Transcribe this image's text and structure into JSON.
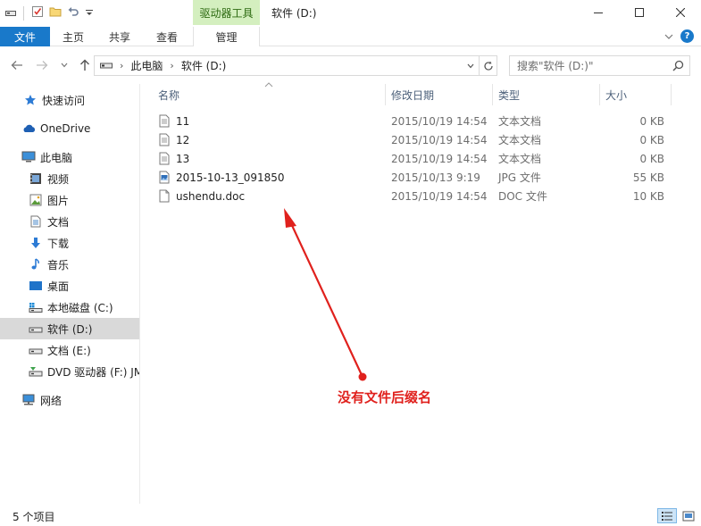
{
  "window": {
    "title": "软件 (D:)",
    "context_tab_header": "驱动器工具",
    "controls": {
      "minimize": "─",
      "maximize": "☐",
      "close": "✕"
    }
  },
  "ribbon": {
    "tabs": [
      {
        "label": "文件"
      },
      {
        "label": "主页"
      },
      {
        "label": "共享"
      },
      {
        "label": "查看"
      },
      {
        "label": "管理"
      }
    ],
    "help_label": "?"
  },
  "address": {
    "crumbs": [
      "此电脑",
      "软件 (D:)"
    ],
    "separator": "›"
  },
  "search": {
    "placeholder": "搜索\"软件 (D:)\""
  },
  "nav": {
    "items": [
      {
        "label": "快速访问",
        "icon": "star-icon"
      },
      {
        "label": "OneDrive",
        "icon": "cloud-icon"
      },
      {
        "label": "此电脑",
        "icon": "computer-icon"
      },
      {
        "label": "视频",
        "icon": "video-icon"
      },
      {
        "label": "图片",
        "icon": "picture-icon"
      },
      {
        "label": "文档",
        "icon": "document-icon"
      },
      {
        "label": "下载",
        "icon": "download-icon"
      },
      {
        "label": "音乐",
        "icon": "music-icon"
      },
      {
        "label": "桌面",
        "icon": "desktop-icon"
      },
      {
        "label": "本地磁盘 (C:)",
        "icon": "windows-drive-icon"
      },
      {
        "label": "软件 (D:)",
        "icon": "drive-icon",
        "selected": true
      },
      {
        "label": "文档 (E:)",
        "icon": "drive-icon"
      },
      {
        "label": "DVD 驱动器 (F:) JM",
        "icon": "dvd-drive-icon"
      },
      {
        "label": "网络",
        "icon": "network-icon"
      }
    ]
  },
  "columns": {
    "name": "名称",
    "date": "修改日期",
    "type": "类型",
    "size": "大小"
  },
  "files": [
    {
      "name": "11",
      "date": "2015/10/19 14:54",
      "type": "文本文档",
      "size": "0 KB",
      "icon": "text-file-icon"
    },
    {
      "name": "12",
      "date": "2015/10/19 14:54",
      "type": "文本文档",
      "size": "0 KB",
      "icon": "text-file-icon"
    },
    {
      "name": "13",
      "date": "2015/10/19 14:54",
      "type": "文本文档",
      "size": "0 KB",
      "icon": "text-file-icon"
    },
    {
      "name": "2015-10-13_091850",
      "date": "2015/10/13 9:19",
      "type": "JPG 文件",
      "size": "55 KB",
      "icon": "image-file-icon"
    },
    {
      "name": "ushendu.doc",
      "date": "2015/10/19 14:54",
      "type": "DOC 文件",
      "size": "10 KB",
      "icon": "doc-file-icon"
    }
  ],
  "annotation": {
    "text": "没有文件后缀名",
    "color": "#e0211d"
  },
  "status": {
    "item_count": "5 个项目"
  },
  "colors": {
    "accent": "#1979ca",
    "context_tab": "#d4efbf",
    "selected_nav": "#d9d9d9",
    "annotation": "#e0211d"
  }
}
